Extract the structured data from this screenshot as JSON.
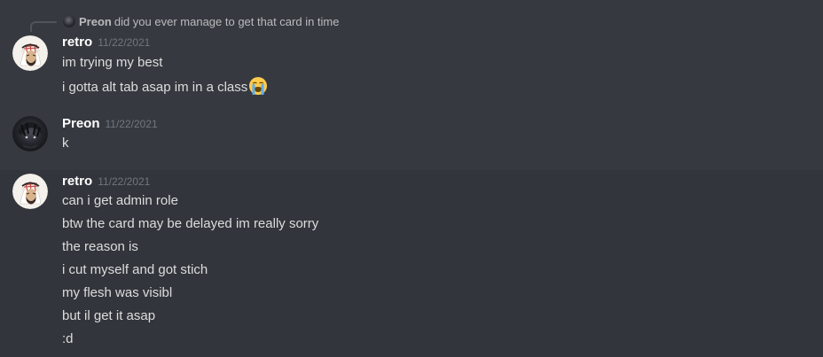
{
  "reply": {
    "username": "Preon",
    "text": "did you ever manage to get that card in time"
  },
  "messages": [
    {
      "username": "retro",
      "timestamp": "11/22/2021",
      "lines": [
        "im trying my best",
        "i gotta alt tab asap im in a class"
      ],
      "emoji": "loudly-crying-face-icon"
    },
    {
      "username": "Preon",
      "timestamp": "11/22/2021",
      "lines": [
        "k"
      ]
    },
    {
      "username": "retro",
      "timestamp": "11/22/2021",
      "lines": [
        "can i get admin role",
        "btw the card may be delayed im really sorry",
        "the reason is",
        "i cut myself and got stich",
        "my flesh was visibl",
        "but il get it asap",
        ":d"
      ]
    }
  ],
  "colors": {
    "background": "#36393f",
    "hover_background": "#32353b",
    "username": "#ffffff",
    "timestamp": "#72767d",
    "text": "#dcddde"
  }
}
